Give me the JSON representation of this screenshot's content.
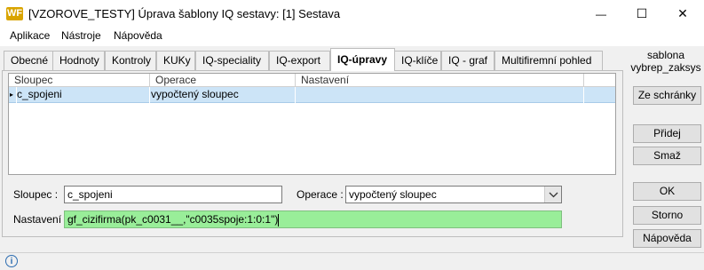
{
  "window": {
    "logo_text": "WF",
    "title": "[VZOROVE_TESTY] Úprava šablony IQ sestavy: [1] Sestava",
    "minimize_glyph": "—",
    "maximize_glyph": "☐",
    "close_glyph": "✕"
  },
  "menu": [
    "Aplikace",
    "Nástroje",
    "Nápověda"
  ],
  "tabs": [
    "Obecné",
    "Hodnoty",
    "Kontroly",
    "KUKy",
    "IQ-speciality",
    "IQ-export",
    "IQ-úpravy",
    "IQ-klíče",
    "IQ - graf",
    "Multifiremní pohled"
  ],
  "active_tab": "IQ-úpravy",
  "grid": {
    "columns": [
      "Sloupec",
      "Operace",
      "Nastavení"
    ],
    "rows": [
      {
        "indicator": "▸",
        "sloupec": "c_spojeni",
        "operace": "vypočtený sloupec",
        "nastaveni": ""
      }
    ],
    "selected_row_color": "#cce4f7"
  },
  "form": {
    "sloupec_label": "Sloupec :",
    "sloupec_value": "c_spojeni",
    "operace_label": "Operace :",
    "operace_value": "vypočtený sloupec",
    "nastaveni_label": "Nastavení :",
    "nastaveni_value": "gf_cizifirma(pk_c0031__,\"c0035spoje:1:0:1\")",
    "nastaveni_bg": "#99ee99"
  },
  "side": {
    "template_name_line1": "sablona",
    "template_name_line2": "vybrep_zaksys",
    "btn_clipboard": "Ze schránky",
    "btn_add": "Přidej",
    "btn_delete": "Smaž",
    "btn_ok": "OK",
    "btn_cancel": "Storno",
    "btn_help": "Nápověda"
  },
  "status": {
    "info_glyph": "i"
  }
}
